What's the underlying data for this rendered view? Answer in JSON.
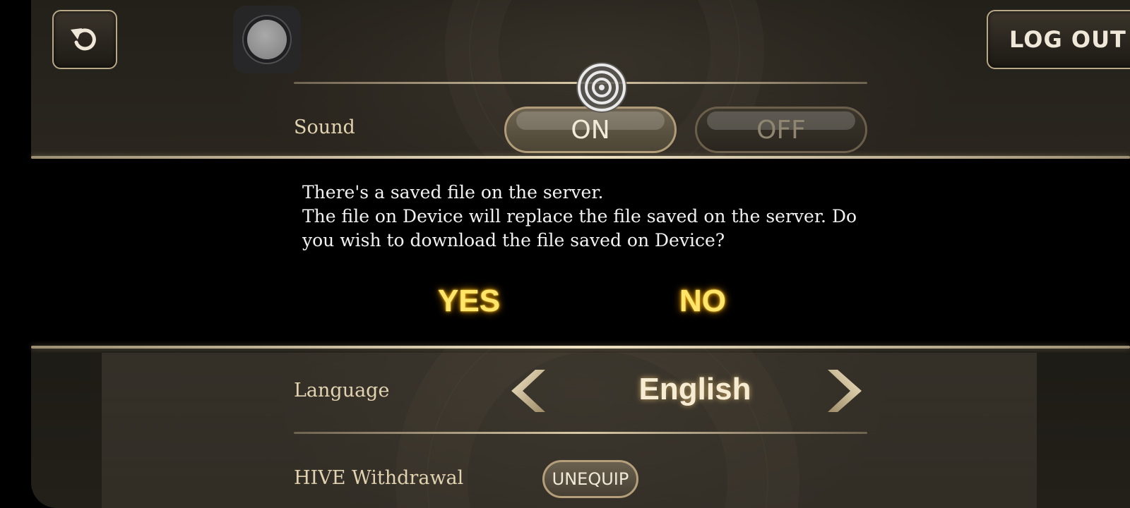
{
  "top_bar": {
    "back_icon": "undo-arrow-icon",
    "logout_label": "LOG OUT",
    "floating_button_icon": "floating-joystick-icon"
  },
  "settings": {
    "sound": {
      "label": "Sound",
      "on_label": "ON",
      "off_label": "OFF",
      "selected": "ON"
    },
    "language": {
      "label": "Language",
      "value": "English",
      "prev_icon": "chevron-left-icon",
      "next_icon": "chevron-right-icon"
    },
    "hive_withdrawal": {
      "label": "HIVE Withdrawal",
      "button_label": "UNEQUIP"
    }
  },
  "dialog": {
    "message": "There's a saved file on the server.\nThe file on Device will replace the file saved on the server. Do you wish to download the file saved on Device?",
    "yes_label": "YES",
    "no_label": "NO"
  },
  "overlay": {
    "touch_indicator_icon": "target-icon"
  },
  "colors": {
    "accent_gold": "#ffe56a",
    "label_text": "#e2d3b0",
    "divider": "#d8c9a6"
  }
}
